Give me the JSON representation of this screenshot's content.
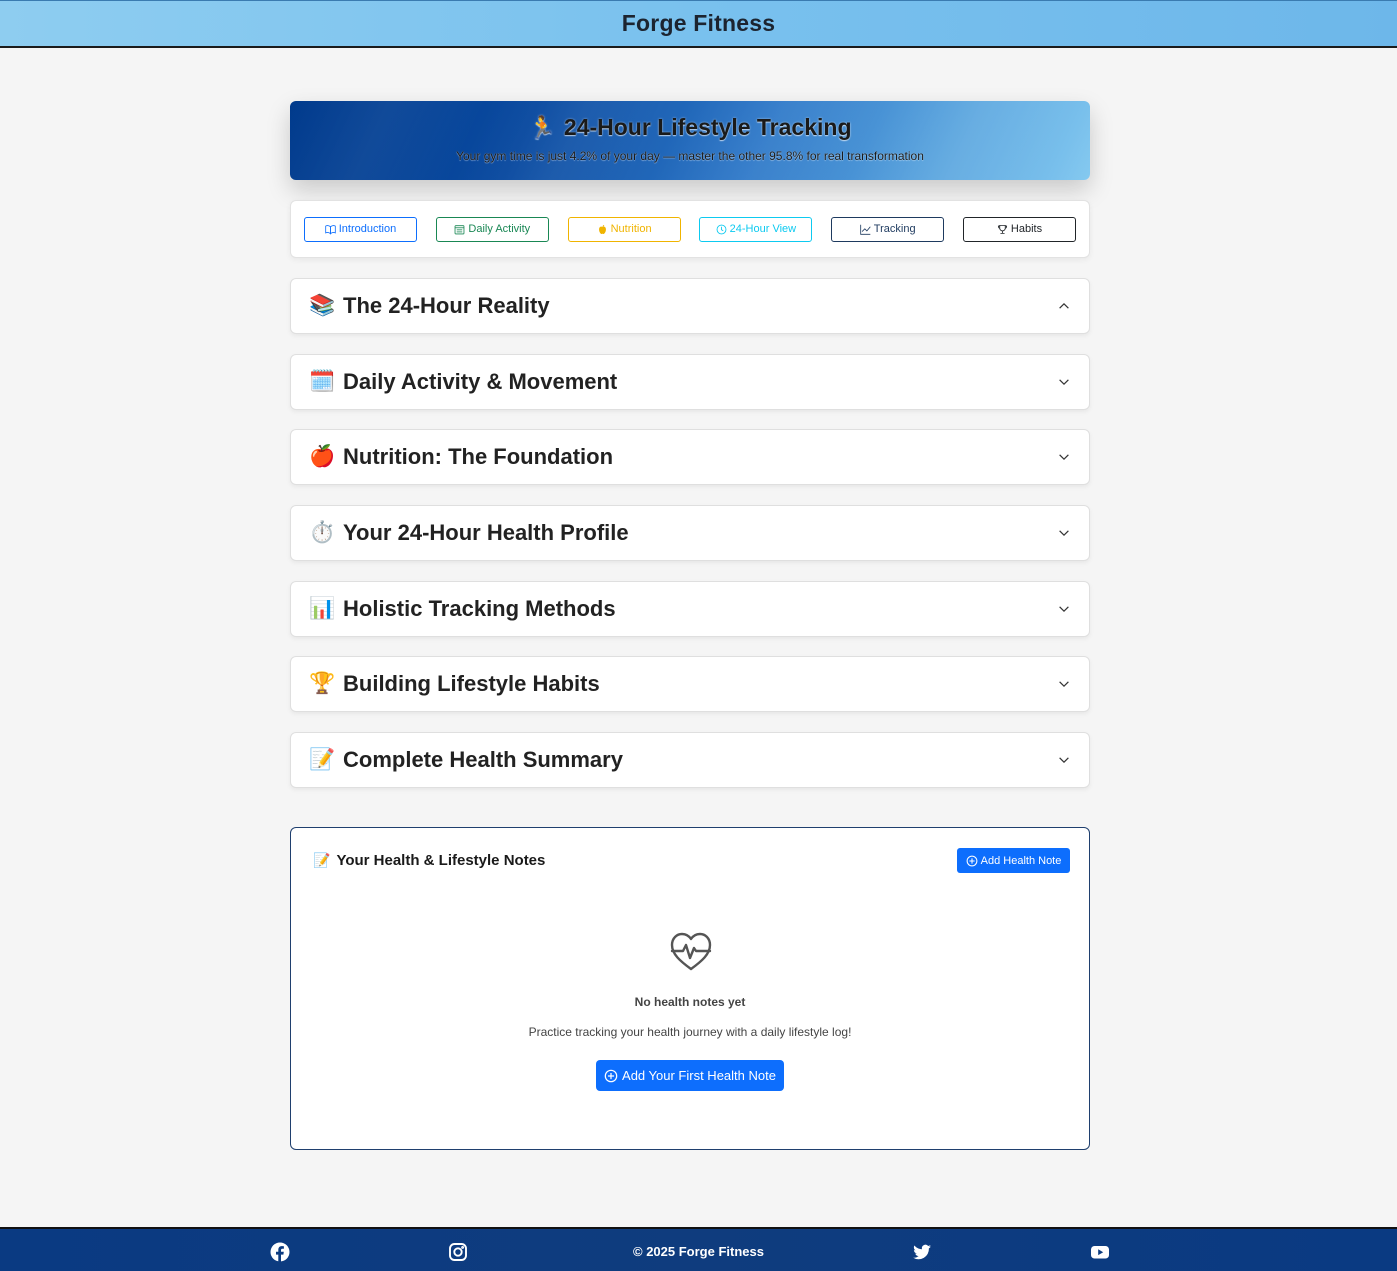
{
  "header": {
    "brand": "Forge Fitness"
  },
  "hero": {
    "icon": "runner-icon",
    "title": "24-Hour Lifestyle Tracking",
    "subtitle": "Your gym time is just 4.2% of your day — master the other 95.8% for real transformation"
  },
  "nav": [
    {
      "label": "Introduction",
      "icon": "book-icon",
      "color": "#0d6efd"
    },
    {
      "label": "Daily Activity",
      "icon": "calendar-icon",
      "color": "#198754"
    },
    {
      "label": "Nutrition",
      "icon": "apple-icon",
      "color": "#f0b400"
    },
    {
      "label": "24-Hour View",
      "icon": "clock-icon",
      "color": "#0dcaf0"
    },
    {
      "label": "Tracking",
      "icon": "chart-line-icon",
      "color": "#1e3a5f"
    },
    {
      "label": "Habits",
      "icon": "trophy-icon",
      "color": "#212529"
    }
  ],
  "sections": [
    {
      "emoji": "📚",
      "title": "The 24-Hour Reality",
      "expanded": true
    },
    {
      "emoji": "🗓️",
      "title": "Daily Activity & Movement",
      "expanded": false
    },
    {
      "emoji": "🍎",
      "title": "Nutrition: The Foundation",
      "expanded": false
    },
    {
      "emoji": "⏱️",
      "title": "Your 24-Hour Health Profile",
      "expanded": false
    },
    {
      "emoji": "📊",
      "title": "Holistic Tracking Methods",
      "expanded": false
    },
    {
      "emoji": "🏆",
      "title": "Building Lifestyle Habits",
      "expanded": false
    },
    {
      "emoji": "📝",
      "title": "Complete Health Summary",
      "expanded": false
    }
  ],
  "notes": {
    "emoji": "📝",
    "heading": "Your Health & Lifestyle Notes",
    "add_label": "Add Health Note",
    "empty_title": "No health notes yet",
    "empty_sub": "Practice tracking your health journey with a daily lifestyle log!",
    "first_label": "Add Your First Health Note"
  },
  "footer": {
    "copyright": "© 2025 Forge Fitness",
    "social": [
      "facebook-icon",
      "instagram-icon",
      "twitter-icon",
      "youtube-icon"
    ]
  },
  "colors": {
    "primary": "#0d6efd",
    "footer": "#0a3a82",
    "header": "#79c1ee"
  }
}
